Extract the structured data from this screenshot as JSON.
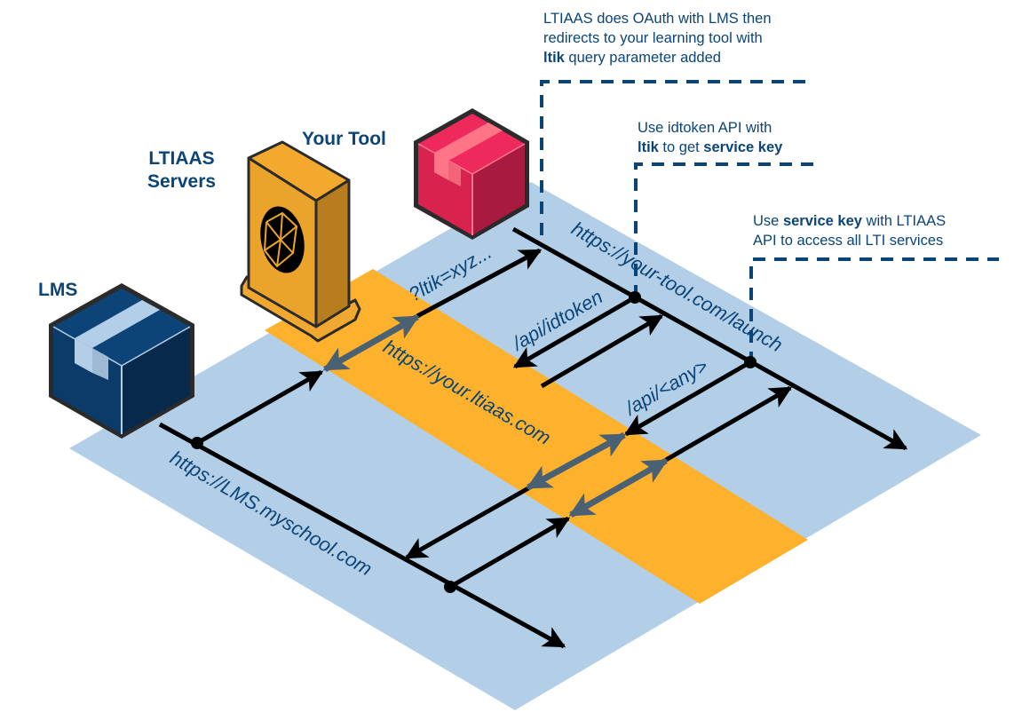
{
  "colors": {
    "plane": "#b3cfe8",
    "band": "#fdb12c",
    "text": "#0b4477",
    "arrow": "#000000",
    "bidir_arrow": "#4a6174",
    "lms_box": "#0d3d6b",
    "tool_box": "#e6285a",
    "server": "#f0a830"
  },
  "nodes": {
    "lms": {
      "label": "LMS",
      "icon": "package-box-icon"
    },
    "ltiaas": {
      "label_line1": "LTIAAS",
      "label_line2": "Servers",
      "icon": "server-tower-icon"
    },
    "tool": {
      "label": "Your Tool",
      "icon": "package-box-icon"
    }
  },
  "urls": {
    "lms": "https://LMS.myschool.com",
    "ltiaas": "https://your.ltiaas.com",
    "tool": "https://your-tool.com/launch"
  },
  "edge_labels": {
    "ltik": "?ltik=xyz...",
    "idtoken": "/api/idtoken",
    "any": "/api/<any>"
  },
  "notes": [
    {
      "lines": [
        [
          {
            "t": "LTIAAS does OAuth with LMS then",
            "b": false
          }
        ],
        [
          {
            "t": "redirects to your learning tool with",
            "b": false
          }
        ],
        [
          {
            "t": "ltik",
            "b": true
          },
          {
            "t": " query parameter added",
            "b": false
          }
        ]
      ]
    },
    {
      "lines": [
        [
          {
            "t": "Use idtoken API with",
            "b": false
          }
        ],
        [
          {
            "t": "ltik",
            "b": true
          },
          {
            "t": " to get ",
            "b": false
          },
          {
            "t": "service key",
            "b": true
          }
        ]
      ]
    },
    {
      "lines": [
        [
          {
            "t": "Use ",
            "b": false
          },
          {
            "t": "service key",
            "b": true
          },
          {
            "t": " with LTIAAS",
            "b": false
          }
        ],
        [
          {
            "t": "API to access all LTI services",
            "b": false
          }
        ]
      ]
    }
  ]
}
